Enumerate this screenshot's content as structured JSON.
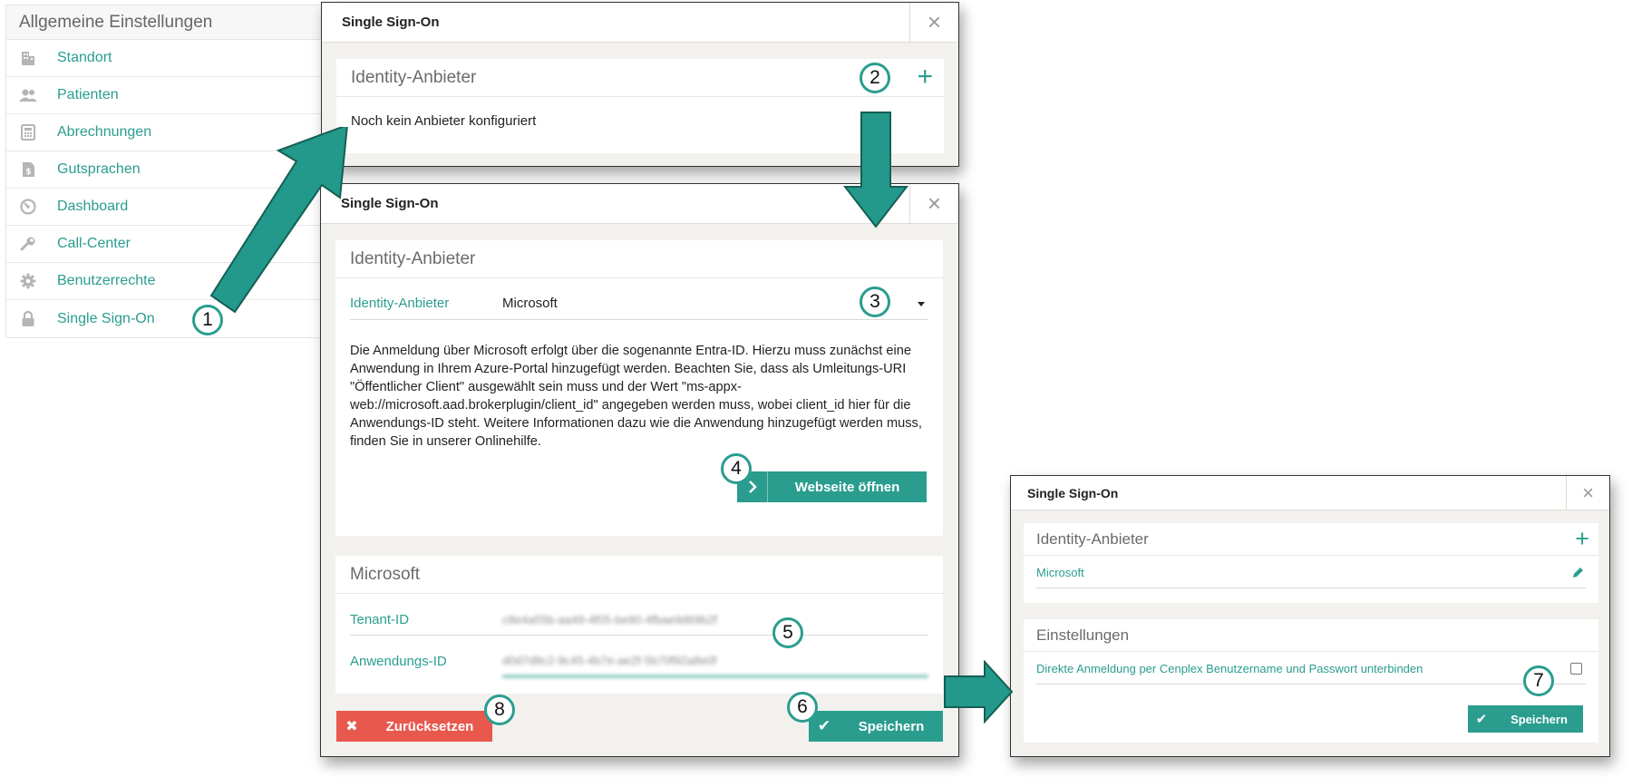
{
  "menu": {
    "header": "Allgemeine Einstellungen",
    "items": [
      {
        "label": "Standort",
        "icon": "building-icon"
      },
      {
        "label": "Patienten",
        "icon": "users-icon"
      },
      {
        "label": "Abrechnungen",
        "icon": "calculator-icon"
      },
      {
        "label": "Gutsprachen",
        "icon": "document-dollar-icon"
      },
      {
        "label": "Dashboard",
        "icon": "dashboard-gauge-icon"
      },
      {
        "label": "Call-Center",
        "icon": "wrench-icon"
      },
      {
        "label": "Benutzerrechte",
        "icon": "gear-icon"
      },
      {
        "label": "Single Sign-On",
        "icon": "lock-icon"
      }
    ]
  },
  "dialog1": {
    "title": "Single Sign-On",
    "close": "×",
    "section_title": "Identity-Anbieter",
    "add": "+",
    "empty_text": "Noch kein Anbieter konfiguriert"
  },
  "dialog2": {
    "title": "Single Sign-On",
    "close": "×",
    "section_title": "Identity-Anbieter",
    "provider_label": "Identity-Anbieter",
    "provider_value": "Microsoft",
    "description": "Die Anmeldung über Microsoft erfolgt über die sogenannte Entra-ID. Hierzu muss zunächst eine Anwendung in Ihrem Azure-Portal hinzugefügt werden. Beachten Sie, dass als Umleitungs-URI \"Öffentlicher Client\" ausgewählt sein muss und der Wert \"ms-appx-web://microsoft.aad.brokerplugin/client_id\" angegeben werden muss, wobei client_id hier für die Anwendungs-ID steht. Weitere Informationen dazu wie die Anwendung hinzugefügt werden muss, finden Sie in unserer Onlinehilfe.",
    "open_website": "Webseite öffnen",
    "ms_section_title": "Microsoft",
    "tenant_label": "Tenant-ID",
    "tenant_value": "c8e4a55b-aa49-4f05-be90-4fbae9d69b2f",
    "app_label": "Anwendungs-ID",
    "app_value": "d0d7d8c2-9c45-4b7e-ae2f-5b70f92a8e0f",
    "reset": "Zurücksetzen",
    "save": "Speichern"
  },
  "dialog3": {
    "title": "Single Sign-On",
    "close": "×",
    "section_title": "Identity-Anbieter",
    "add": "+",
    "provider": "Microsoft",
    "settings_title": "Einstellungen",
    "setting_label": "Direkte Anmeldung per Cenplex Benutzername und Passwort unterbinden",
    "save": "Speichern"
  },
  "badges": [
    "1",
    "2",
    "3",
    "4",
    "5",
    "6",
    "7",
    "8"
  ],
  "colors": {
    "accent": "#2a9d8f",
    "danger": "#e8584c",
    "arrow": "#22998a"
  }
}
